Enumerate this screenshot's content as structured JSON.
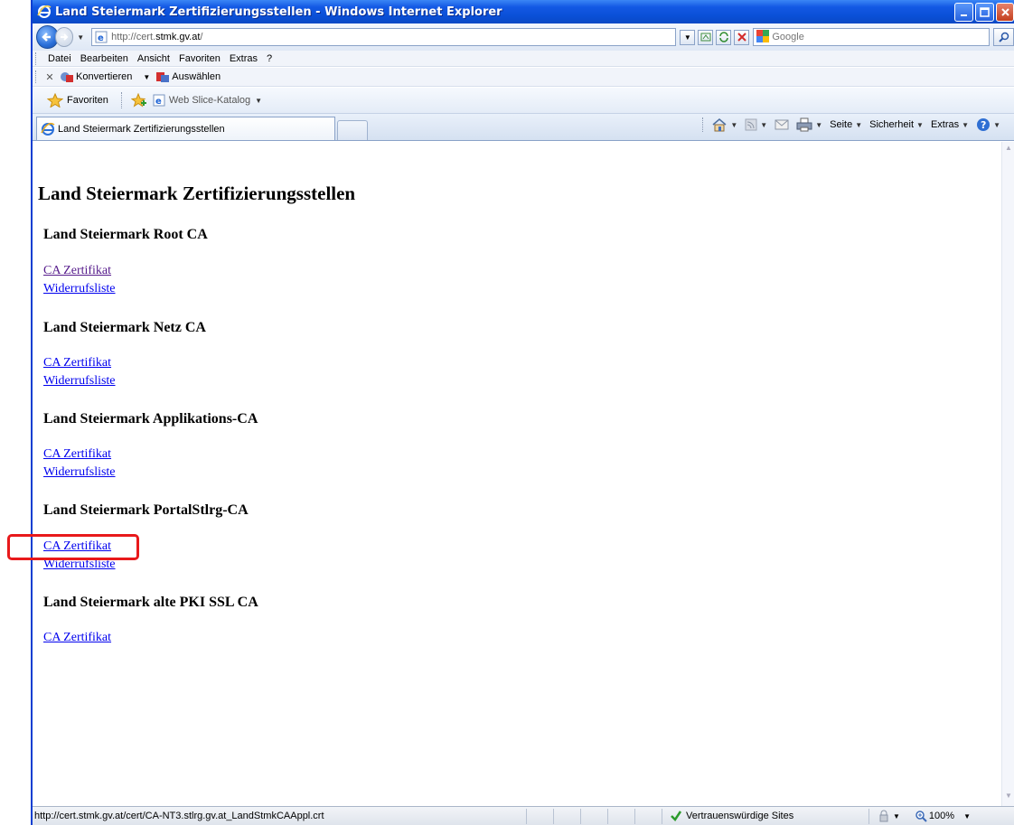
{
  "window": {
    "title": "Land Steiermark Zertifizierungsstellen - Windows Internet Explorer"
  },
  "address_bar": {
    "url_prefix": "http://cert.",
    "url_host": "stmk.gv.at",
    "url_suffix": "/",
    "search_placeholder": "Google"
  },
  "menu": {
    "items": [
      "Datei",
      "Bearbeiten",
      "Ansicht",
      "Favoriten",
      "Extras",
      "?"
    ]
  },
  "converter_bar": {
    "convert_label": "Konvertieren",
    "select_label": "Auswählen"
  },
  "favorites_bar": {
    "favorites_label": "Favoriten",
    "web_slice_label": "Web Slice-Katalog"
  },
  "tabs": {
    "active_label": "Land Steiermark Zertifizierungsstellen"
  },
  "command_bar": {
    "page_label": "Seite",
    "safety_label": "Sicherheit",
    "tools_label": "Extras"
  },
  "page": {
    "heading": "Land Steiermark Zertifizierungsstellen",
    "sections": [
      {
        "title": "Land Steiermark Root CA",
        "cert_link": "CA Zertifikat",
        "crl_link": "Widerrufsliste"
      },
      {
        "title": "Land Steiermark Netz CA",
        "cert_link": "CA Zertifikat",
        "crl_link": "Widerrufsliste"
      },
      {
        "title": "Land Steiermark Applikations-CA",
        "cert_link": "CA Zertifikat",
        "crl_link": "Widerrufsliste"
      },
      {
        "title": "Land Steiermark PortalStlrg-CA",
        "cert_link": "CA Zertifikat",
        "crl_link": "Widerrufsliste"
      },
      {
        "title": "Land Steiermark alte PKI SSL CA",
        "cert_link": "CA Zertifikat"
      }
    ]
  },
  "status_bar": {
    "text": "http://cert.stmk.gv.at/cert/CA-NT3.stlrg.gv.at_LandStmkCAAppl.crt",
    "zone": "Vertrauenswürdige Sites",
    "zoom": "100%"
  },
  "colors": {
    "link": "#0000ee",
    "visited_link": "#551a8b",
    "highlight": "#e8191b",
    "titlebar": "#0a4fd6"
  }
}
